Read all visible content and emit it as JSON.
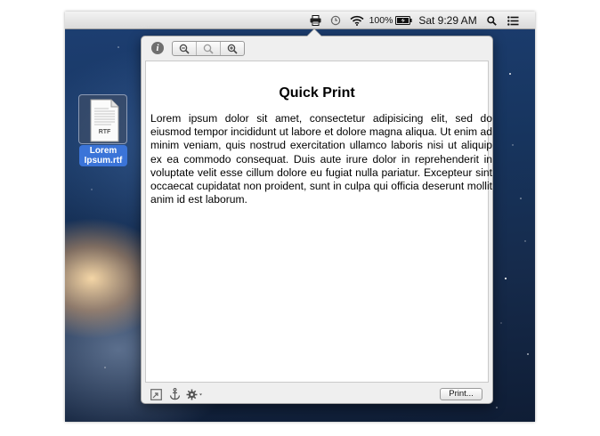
{
  "menubar": {
    "icons": [
      "printer-icon",
      "time-machine-icon",
      "wifi-icon",
      "battery-icon",
      "spotlight-icon",
      "notification-center-icon"
    ],
    "battery_percent": "100%",
    "clock": "Sat 9:29 AM"
  },
  "desktop": {
    "file_badge": "RTF",
    "file_name_line1": "Lorem",
    "file_name_line2": "Ipsum.rtf"
  },
  "popover": {
    "toolbar": {
      "info_label": "i",
      "zoom_icons": [
        "zoom-out-icon",
        "zoom-actual-icon",
        "zoom-in-icon"
      ]
    },
    "document": {
      "title": "Quick Print",
      "body": "Lorem ipsum dolor sit amet, consectetur adipisicing elit, sed do eiusmod tempor incididunt ut labore et dolore magna aliqua. Ut enim ad minim veniam, quis nostrud exercitation ullamco laboris nisi ut aliquip ex ea commodo consequat. Duis aute irure dolor in reprehenderit in voluptate velit esse cillum dolore eu fugiat nulla pariatur. Excepteur sint occaecat cupidatat non proident, sunt in culpa qui officia deserunt mollit anim id est laborum."
    },
    "bottom_icons": [
      "detach-icon",
      "anchor-icon",
      "gear-icon"
    ],
    "print_button": "Print..."
  },
  "colors": {
    "selection_blue": "#3b74d8",
    "menubar": "#e6e6e6",
    "popover": "#efefef"
  }
}
